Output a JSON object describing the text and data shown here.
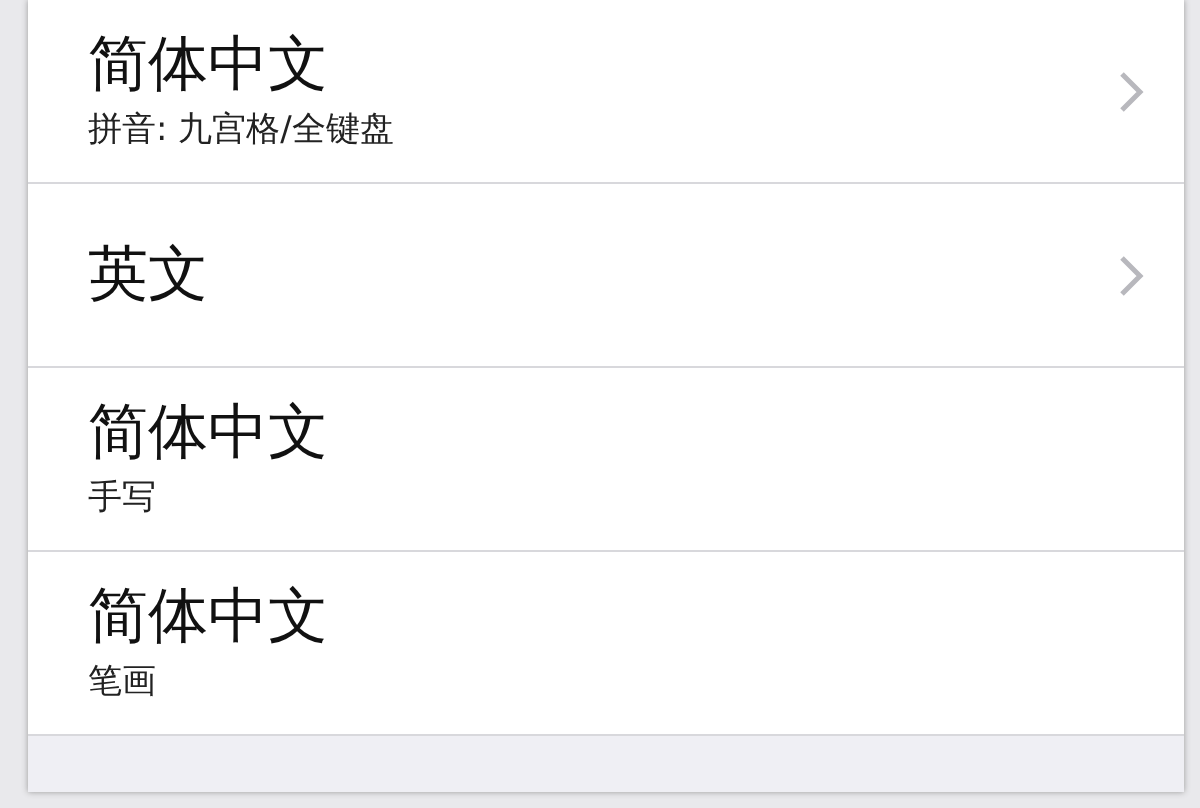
{
  "rows": [
    {
      "title": "简体中文",
      "subtitle": "拼音: 九宫格/全键盘",
      "chevron": true
    },
    {
      "title": "英文",
      "chevron": true
    },
    {
      "title": "简体中文",
      "subtitle": "手写",
      "chevron": false
    },
    {
      "title": "简体中文",
      "subtitle": "笔画",
      "chevron": false
    }
  ]
}
